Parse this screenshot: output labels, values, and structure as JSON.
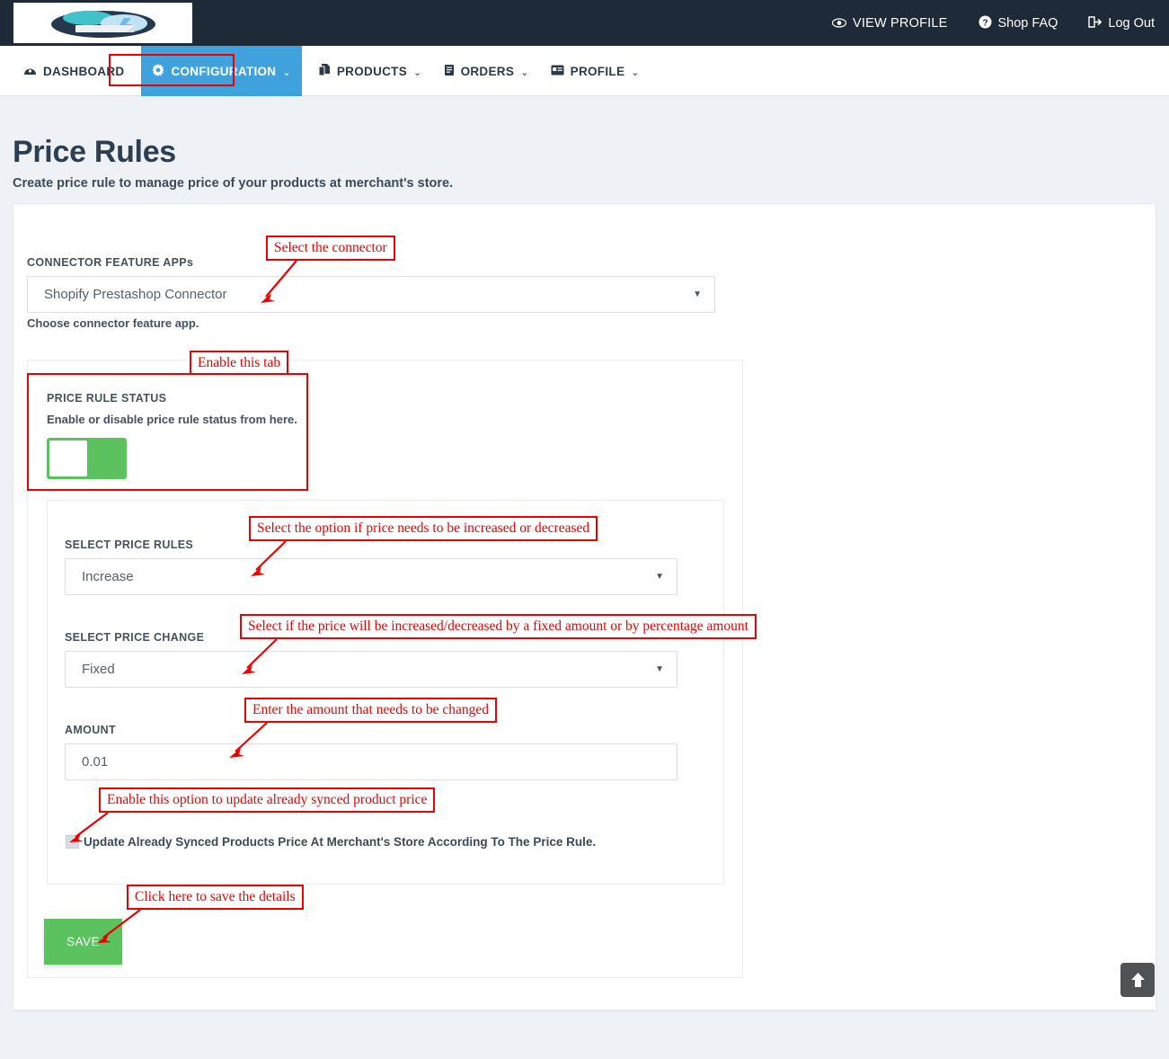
{
  "topbar": {
    "logo_name": "shopify-prestashop-connector-logo",
    "links": [
      {
        "label": "VIEW PROFILE",
        "icon": "eye-icon",
        "glyph": "◉",
        "upper": true
      },
      {
        "label": "Shop FAQ",
        "icon": "question-circle-icon",
        "glyph": "❓",
        "upper": false
      },
      {
        "label": "Log Out",
        "icon": "logout-icon",
        "glyph": "↪",
        "upper": false
      }
    ]
  },
  "mainnav": {
    "items": [
      {
        "label": "DASHBOARD",
        "icon": "dashboard-icon",
        "glyph": "◔",
        "caret": "",
        "active": false
      },
      {
        "label": "CONFIGURATION",
        "icon": "gear-icon",
        "glyph": "⚙",
        "caret": "⌄",
        "active": true
      },
      {
        "label": "PRODUCTS",
        "icon": "copy-icon",
        "glyph": "❐",
        "caret": "⌄",
        "active": false
      },
      {
        "label": "ORDERS",
        "icon": "clipboard-icon",
        "glyph": "☰",
        "caret": "⌄",
        "active": false
      },
      {
        "label": "PROFILE",
        "icon": "id-card-icon",
        "glyph": "▤",
        "caret": "⌄",
        "active": false
      }
    ]
  },
  "page": {
    "title": "Price Rules",
    "subtitle": "Create price rule to manage price of your products at merchant's store."
  },
  "form": {
    "connector": {
      "label": "CONNECTOR FEATURE APPs",
      "value": "Shopify Prestashop Connector",
      "help": "Choose connector feature app.",
      "arrow": "▼"
    },
    "status": {
      "label": "PRICE RULE STATUS",
      "help": "Enable or disable price rule status from here.",
      "enabled": true
    },
    "price_rules": {
      "label": "SELECT PRICE RULES",
      "value": "Increase",
      "arrow": "▼"
    },
    "price_change": {
      "label": "SELECT PRICE CHANGE",
      "value": "Fixed",
      "arrow": "▼"
    },
    "amount": {
      "label": "AMOUNT",
      "value": "0.01"
    },
    "update_synced": {
      "label": "Update Already Synced Products Price At Merchant's Store According To The Price Rule.",
      "checked": false
    },
    "save_label": "SAVE"
  },
  "annotations": [
    {
      "id": "connector",
      "text": "Select the connector"
    },
    {
      "id": "enable_tab",
      "text": "Enable this tab"
    },
    {
      "id": "price_rules",
      "text": "Select the option if price needs to be increased or decreased"
    },
    {
      "id": "price_change",
      "text": "Select if the price will be increased/decreased by a fixed amount or by percentage amount"
    },
    {
      "id": "amount",
      "text": "Enter the amount that needs to be changed"
    },
    {
      "id": "update_synced",
      "text": "Enable this option to update already synced product price"
    },
    {
      "id": "save",
      "text": "Click here to save the details"
    }
  ],
  "colors": {
    "topbar": "#1e2a38",
    "nav_active": "#3fa2dd",
    "annotation_red": "#ee0000",
    "green": "#5cc15f",
    "page_bg": "#eef2f7"
  },
  "scroll_top": {
    "icon": "arrow-up-icon"
  }
}
